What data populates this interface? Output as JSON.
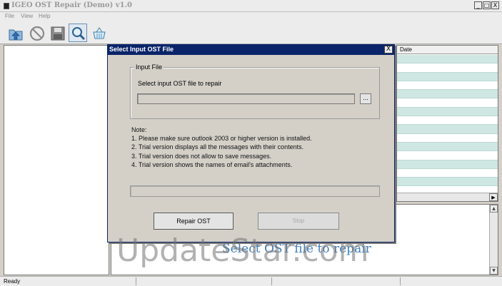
{
  "window": {
    "title": "IGEO OST Repair (Demo) v1.0",
    "controls": [
      "_",
      "□",
      "X"
    ]
  },
  "menu": [
    "File",
    "View",
    "Help"
  ],
  "toolbar": {
    "buttons": [
      {
        "icon": "open-upload-icon"
      },
      {
        "icon": "stop-cancel-icon"
      },
      {
        "icon": "save-disk-icon"
      },
      {
        "icon": "search-magnifier-icon"
      },
      {
        "icon": "basket-icon"
      }
    ]
  },
  "list": {
    "column_header": "Date",
    "row_count": 16
  },
  "preview": {
    "text": "Select OST file to repair"
  },
  "status": {
    "text": "Ready"
  },
  "dialog": {
    "title": "Select Input OST File",
    "close": "X",
    "group_title": "Input File",
    "field_label": "Select input OST file to repair",
    "path_value": "",
    "browse_label": "...",
    "note_title": "Note:",
    "notes": [
      "1. Please make sure outlook 2003 or higher version is installed.",
      "2. Trial version displays all the messages with their contents.",
      "3. Trial version does not allow to save messages.",
      "4. Trial version shows the names of email's attachments."
    ],
    "progress": 0,
    "repair_button": "Repair OST",
    "stop_button": "Stop"
  },
  "watermark": "UpdateStar.com"
}
